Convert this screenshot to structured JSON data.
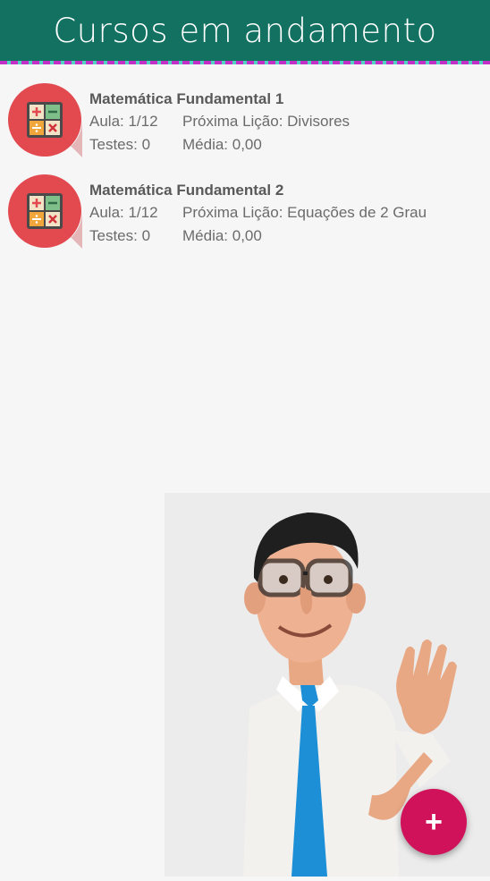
{
  "header": {
    "title": "Cursos em andamento"
  },
  "courses": [
    {
      "title": "Matemática Fundamental 1",
      "aula": "Aula: 1/12",
      "proxima": "Próxima Lição: Divisores",
      "testes": "Testes: 0",
      "media": "Média: 0,00"
    },
    {
      "title": "Matemática Fundamental 2",
      "aula": "Aula: 1/12",
      "proxima": "Próxima Lição: Equações de 2 Grau",
      "testes": "Testes: 0",
      "media": "Média: 0,00"
    }
  ],
  "fab": {
    "label": "+",
    "icon": "plus-icon"
  },
  "colors": {
    "header": "#137162",
    "accent": "#d0125a",
    "icon_circle": "#e24a50"
  }
}
